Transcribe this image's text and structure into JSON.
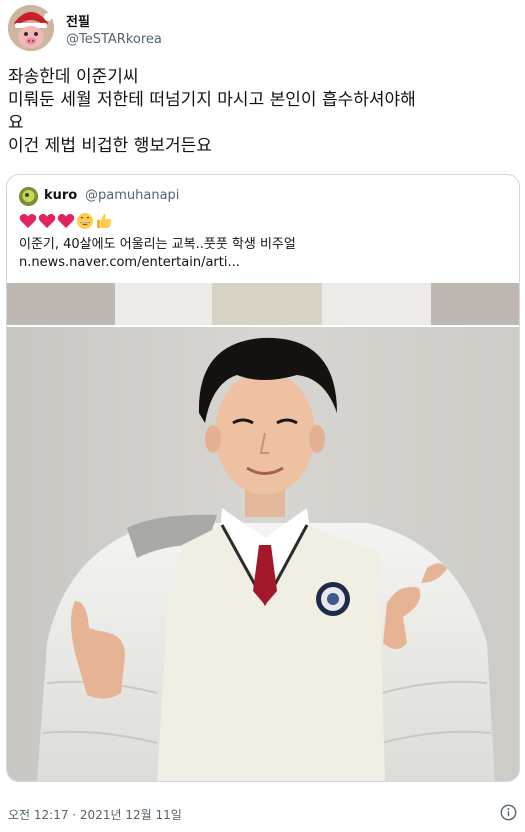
{
  "tweet": {
    "author": {
      "display_name": "전필",
      "handle": "@TeSTARkorea"
    },
    "text_lines": [
      "좌송한데 이준기씨",
      "미뤄둔 세월 저한테 떠넘기지 마시고 본인이 흡수하셔야해",
      "요",
      "이건 제법 비겁한 행보거든요"
    ],
    "timestamp": "오전 12:17 · 2021년 12월 11일"
  },
  "quoted_tweet": {
    "author": {
      "display_name": "kuro",
      "handle": "@pamuhanapi"
    },
    "emojis": [
      "heart-icon",
      "heart-icon",
      "heart-icon",
      "grin-icon",
      "thumbs-up-icon"
    ],
    "text_line1": "이준기, 40살에도 어울리는 교복..풋풋 학생 비주얼",
    "link": "n.news.naver.com/entertain/arti..."
  },
  "colors": {
    "text": "#0f1419",
    "secondary": "#536471",
    "border": "#cfd9de",
    "heart": "#e0245e"
  }
}
